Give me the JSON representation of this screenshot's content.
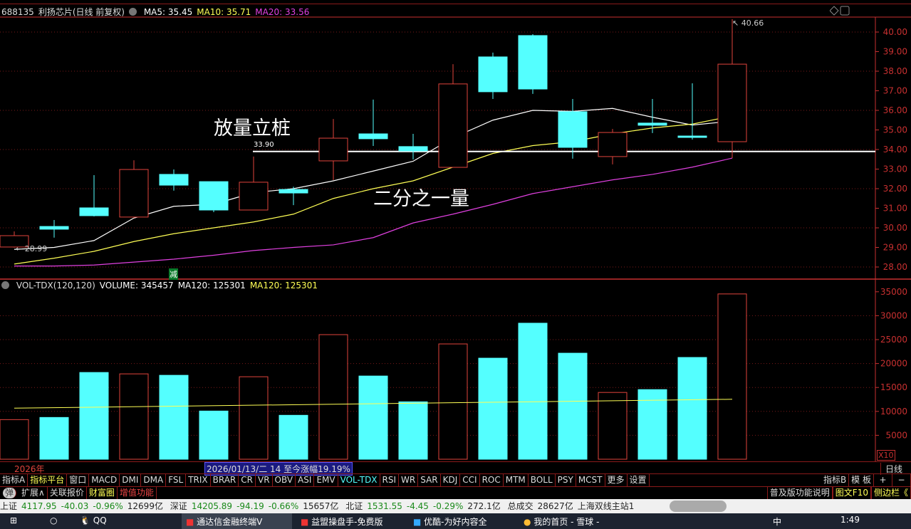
{
  "header": {
    "code": "688135",
    "name": "利扬芯片(日线 前复权)",
    "ma5": "MA5: 35.45",
    "ma10": "MA10: 35.71",
    "ma20": "MA20: 33.56"
  },
  "colors": {
    "up": "#e0443c",
    "down": "#54ffff",
    "ma5": "#ffffff",
    "ma10": "#ffff55",
    "ma20": "#e040e0",
    "axis": "#c83030",
    "grid": "#7a1a1a"
  },
  "annotations": {
    "a1": "放量立桩",
    "a2": "二分之一量",
    "level": "33.90",
    "low_marker": "28.99",
    "high_marker": "40.66",
    "signal": "减"
  },
  "volume_header": {
    "name": "VOL-TDX(120,120)",
    "volume": "VOLUME: 345457",
    "ma120a": "MA120: 125301",
    "ma120b": "MA120: 125301",
    "unit": "X10"
  },
  "chart_data": [
    {
      "type": "candlestick",
      "ylim": [
        27.6,
        40.9
      ],
      "yticks": [
        "40.00",
        "39.00",
        "38.00",
        "37.00",
        "36.00",
        "35.00",
        "34.00",
        "33.00",
        "32.00",
        "31.00",
        "30.00",
        "29.00",
        "28.00"
      ],
      "ohlc": [
        [
          29.02,
          29.82,
          28.99,
          29.6
        ],
        [
          30.07,
          30.4,
          29.5,
          29.93
        ],
        [
          31.02,
          32.69,
          30.58,
          30.62
        ],
        [
          30.55,
          33.45,
          30.5,
          32.98
        ],
        [
          32.73,
          32.98,
          31.9,
          32.18
        ],
        [
          32.36,
          32.36,
          30.8,
          30.91
        ],
        [
          30.91,
          33.64,
          30.91,
          32.33
        ],
        [
          31.96,
          32.1,
          31.16,
          31.78
        ],
        [
          33.42,
          35.56,
          32.44,
          34.58
        ],
        [
          34.8,
          36.55,
          34.18,
          34.55
        ],
        [
          34.15,
          34.8,
          33.49,
          33.93
        ],
        [
          33.09,
          38.36,
          33.09,
          37.35
        ],
        [
          38.73,
          38.95,
          36.58,
          36.95
        ],
        [
          39.82,
          39.89,
          36.84,
          37.09
        ],
        [
          35.93,
          36.58,
          33.53,
          34.11
        ],
        [
          33.64,
          35.05,
          33.24,
          34.87
        ],
        [
          35.35,
          36.58,
          34.84,
          35.24
        ],
        [
          34.69,
          37.38,
          34.51,
          34.62
        ],
        [
          34.4,
          40.66,
          33.56,
          38.36
        ]
      ],
      "series": [
        {
          "name": "MA5",
          "values": [
            28.9,
            29.0,
            29.35,
            30.5,
            31.1,
            31.2,
            31.8,
            32.0,
            32.4,
            32.9,
            33.4,
            34.6,
            35.5,
            36.0,
            35.95,
            36.1,
            35.65,
            35.25,
            35.45
          ]
        },
        {
          "name": "MA10",
          "values": [
            28.15,
            28.45,
            28.8,
            29.3,
            29.7,
            30.0,
            30.3,
            30.7,
            31.5,
            32.0,
            32.4,
            33.1,
            33.8,
            34.2,
            34.4,
            34.8,
            35.1,
            35.3,
            35.71
          ]
        },
        {
          "name": "MA20",
          "values": [
            28.05,
            28.05,
            28.1,
            28.25,
            28.4,
            28.6,
            28.84,
            29.0,
            29.13,
            29.5,
            30.25,
            30.7,
            31.2,
            31.75,
            32.1,
            32.45,
            32.73,
            33.1,
            33.56
          ]
        }
      ]
    },
    {
      "type": "bar",
      "ylim": [
        0,
        35500
      ],
      "yticks": [
        "35000",
        "30000",
        "25000",
        "20000",
        "15000",
        "10000",
        "5000"
      ],
      "values": [
        8280,
        8730,
        18130,
        17840,
        17540,
        10070,
        17240,
        9180,
        26040,
        17390,
        12000,
        24100,
        21120,
        28430,
        22160,
        13960,
        14550,
        21270,
        34546
      ],
      "ma120": [
        10670,
        12530
      ]
    }
  ],
  "footer": {
    "year": "2026年",
    "range": "2026/01/13/二 14 至今涨幅19.19%",
    "period": "日线",
    "tabs": [
      "指标A",
      "指标平台",
      "窗口",
      "MACD",
      "DMI",
      "DMA",
      "FSL",
      "TRIX",
      "BRAR",
      "CR",
      "VR",
      "OBV",
      "ASI",
      "EMV",
      "VOL-TDX",
      "RSI",
      "WR",
      "SAR",
      "KDJ",
      "CCI",
      "ROC",
      "MTM",
      "BOLL",
      "PSY",
      "MCST",
      "更多",
      "设置"
    ],
    "right_tabs": [
      "指标B",
      "模 板",
      "+",
      "−"
    ],
    "row3": [
      "弹",
      "扩展∧",
      "关联报价",
      "财富圈",
      "增值功能"
    ],
    "row3_right": [
      "普及版功能说明",
      "图文F10",
      "侧边栏《"
    ]
  },
  "status": {
    "sh": "上证",
    "sh_v": "4117.95",
    "sh_c": "-40.03",
    "sh_p": "-0.96%",
    "sh_a": "12699亿",
    "sz": "深证",
    "sz_v": "14205.89",
    "sz_c": "-94.19",
    "sz_p": "-0.66%",
    "sz_a": "15657亿",
    "bz": "北证",
    "bz_v": "1531.55",
    "bz_c": "-4.45",
    "bz_p": "-0.29%",
    "bz_a": "272.1亿",
    "total_l": "总成交",
    "total": "28627亿",
    "server": "上海双线主站1"
  },
  "taskbar": {
    "qq": "QQ",
    "app1": "通达信金融终端V",
    "app2": "益盟操盘手-免费版",
    "app3": "优酷-为好内容全",
    "app4": "我的首页 - 雪球 -",
    "ime": "中",
    "time": "1:49"
  }
}
